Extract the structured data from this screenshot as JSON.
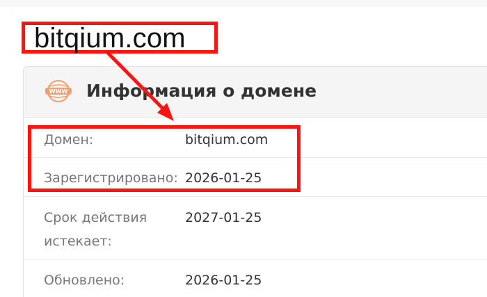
{
  "callout": {
    "domain_text": "bitqium.com"
  },
  "card": {
    "icon": "www-globe-icon",
    "title": "Информация о домене",
    "rows": [
      {
        "label": "Домен:",
        "value": "bitqium.com"
      },
      {
        "label": "Зарегистрировано:",
        "value": "2026-01-25"
      },
      {
        "label": "Срок действия истекает:",
        "label_line1": "Срок действия",
        "label_line2": "истекает:",
        "value": "2027-01-25"
      },
      {
        "label": "Обновлено:",
        "value": "2026-01-25"
      }
    ]
  },
  "colors": {
    "highlight": "#ff1212",
    "icon_accent": "#f0a070",
    "header_bg": "#f5f5f5",
    "label_text": "#777777",
    "value_text": "#333333"
  }
}
